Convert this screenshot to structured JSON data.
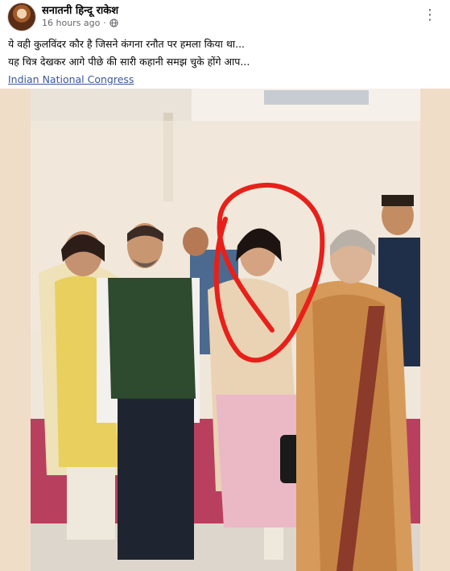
{
  "post": {
    "author": "सनातनी हिन्दू राकेश",
    "time": "16 hours ago",
    "separator": "·",
    "privacy_icon": "globe-icon",
    "more_icon": "more-options-icon",
    "more_glyph": "⋮",
    "lines": [
      "ये वही कुलविंदर कौर है जिसने कंगना रनौत पर हमला किया था...",
      "यह चित्र देखकर आगे पीछे की सारी कहानी समझ चुके होंगे आप..."
    ],
    "hashtag": "Indian National Congress"
  },
  "photo": {
    "annotation": "red-circle-highlight",
    "colors": {
      "frame_bg": "#f0ddc8",
      "circle": "#e8201a",
      "wall": "#efe7da",
      "carpet": "#b8405e"
    }
  }
}
